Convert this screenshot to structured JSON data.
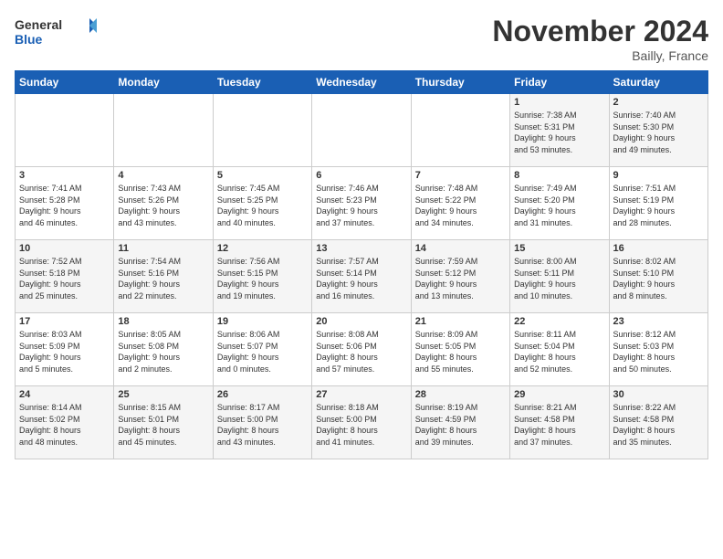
{
  "header": {
    "logo_line1": "General",
    "logo_line2": "Blue",
    "month": "November 2024",
    "location": "Bailly, France"
  },
  "weekdays": [
    "Sunday",
    "Monday",
    "Tuesday",
    "Wednesday",
    "Thursday",
    "Friday",
    "Saturday"
  ],
  "weeks": [
    [
      {
        "day": "",
        "text": ""
      },
      {
        "day": "",
        "text": ""
      },
      {
        "day": "",
        "text": ""
      },
      {
        "day": "",
        "text": ""
      },
      {
        "day": "",
        "text": ""
      },
      {
        "day": "1",
        "text": "Sunrise: 7:38 AM\nSunset: 5:31 PM\nDaylight: 9 hours\nand 53 minutes."
      },
      {
        "day": "2",
        "text": "Sunrise: 7:40 AM\nSunset: 5:30 PM\nDaylight: 9 hours\nand 49 minutes."
      }
    ],
    [
      {
        "day": "3",
        "text": "Sunrise: 7:41 AM\nSunset: 5:28 PM\nDaylight: 9 hours\nand 46 minutes."
      },
      {
        "day": "4",
        "text": "Sunrise: 7:43 AM\nSunset: 5:26 PM\nDaylight: 9 hours\nand 43 minutes."
      },
      {
        "day": "5",
        "text": "Sunrise: 7:45 AM\nSunset: 5:25 PM\nDaylight: 9 hours\nand 40 minutes."
      },
      {
        "day": "6",
        "text": "Sunrise: 7:46 AM\nSunset: 5:23 PM\nDaylight: 9 hours\nand 37 minutes."
      },
      {
        "day": "7",
        "text": "Sunrise: 7:48 AM\nSunset: 5:22 PM\nDaylight: 9 hours\nand 34 minutes."
      },
      {
        "day": "8",
        "text": "Sunrise: 7:49 AM\nSunset: 5:20 PM\nDaylight: 9 hours\nand 31 minutes."
      },
      {
        "day": "9",
        "text": "Sunrise: 7:51 AM\nSunset: 5:19 PM\nDaylight: 9 hours\nand 28 minutes."
      }
    ],
    [
      {
        "day": "10",
        "text": "Sunrise: 7:52 AM\nSunset: 5:18 PM\nDaylight: 9 hours\nand 25 minutes."
      },
      {
        "day": "11",
        "text": "Sunrise: 7:54 AM\nSunset: 5:16 PM\nDaylight: 9 hours\nand 22 minutes."
      },
      {
        "day": "12",
        "text": "Sunrise: 7:56 AM\nSunset: 5:15 PM\nDaylight: 9 hours\nand 19 minutes."
      },
      {
        "day": "13",
        "text": "Sunrise: 7:57 AM\nSunset: 5:14 PM\nDaylight: 9 hours\nand 16 minutes."
      },
      {
        "day": "14",
        "text": "Sunrise: 7:59 AM\nSunset: 5:12 PM\nDaylight: 9 hours\nand 13 minutes."
      },
      {
        "day": "15",
        "text": "Sunrise: 8:00 AM\nSunset: 5:11 PM\nDaylight: 9 hours\nand 10 minutes."
      },
      {
        "day": "16",
        "text": "Sunrise: 8:02 AM\nSunset: 5:10 PM\nDaylight: 9 hours\nand 8 minutes."
      }
    ],
    [
      {
        "day": "17",
        "text": "Sunrise: 8:03 AM\nSunset: 5:09 PM\nDaylight: 9 hours\nand 5 minutes."
      },
      {
        "day": "18",
        "text": "Sunrise: 8:05 AM\nSunset: 5:08 PM\nDaylight: 9 hours\nand 2 minutes."
      },
      {
        "day": "19",
        "text": "Sunrise: 8:06 AM\nSunset: 5:07 PM\nDaylight: 9 hours\nand 0 minutes."
      },
      {
        "day": "20",
        "text": "Sunrise: 8:08 AM\nSunset: 5:06 PM\nDaylight: 8 hours\nand 57 minutes."
      },
      {
        "day": "21",
        "text": "Sunrise: 8:09 AM\nSunset: 5:05 PM\nDaylight: 8 hours\nand 55 minutes."
      },
      {
        "day": "22",
        "text": "Sunrise: 8:11 AM\nSunset: 5:04 PM\nDaylight: 8 hours\nand 52 minutes."
      },
      {
        "day": "23",
        "text": "Sunrise: 8:12 AM\nSunset: 5:03 PM\nDaylight: 8 hours\nand 50 minutes."
      }
    ],
    [
      {
        "day": "24",
        "text": "Sunrise: 8:14 AM\nSunset: 5:02 PM\nDaylight: 8 hours\nand 48 minutes."
      },
      {
        "day": "25",
        "text": "Sunrise: 8:15 AM\nSunset: 5:01 PM\nDaylight: 8 hours\nand 45 minutes."
      },
      {
        "day": "26",
        "text": "Sunrise: 8:17 AM\nSunset: 5:00 PM\nDaylight: 8 hours\nand 43 minutes."
      },
      {
        "day": "27",
        "text": "Sunrise: 8:18 AM\nSunset: 5:00 PM\nDaylight: 8 hours\nand 41 minutes."
      },
      {
        "day": "28",
        "text": "Sunrise: 8:19 AM\nSunset: 4:59 PM\nDaylight: 8 hours\nand 39 minutes."
      },
      {
        "day": "29",
        "text": "Sunrise: 8:21 AM\nSunset: 4:58 PM\nDaylight: 8 hours\nand 37 minutes."
      },
      {
        "day": "30",
        "text": "Sunrise: 8:22 AM\nSunset: 4:58 PM\nDaylight: 8 hours\nand 35 minutes."
      }
    ]
  ]
}
